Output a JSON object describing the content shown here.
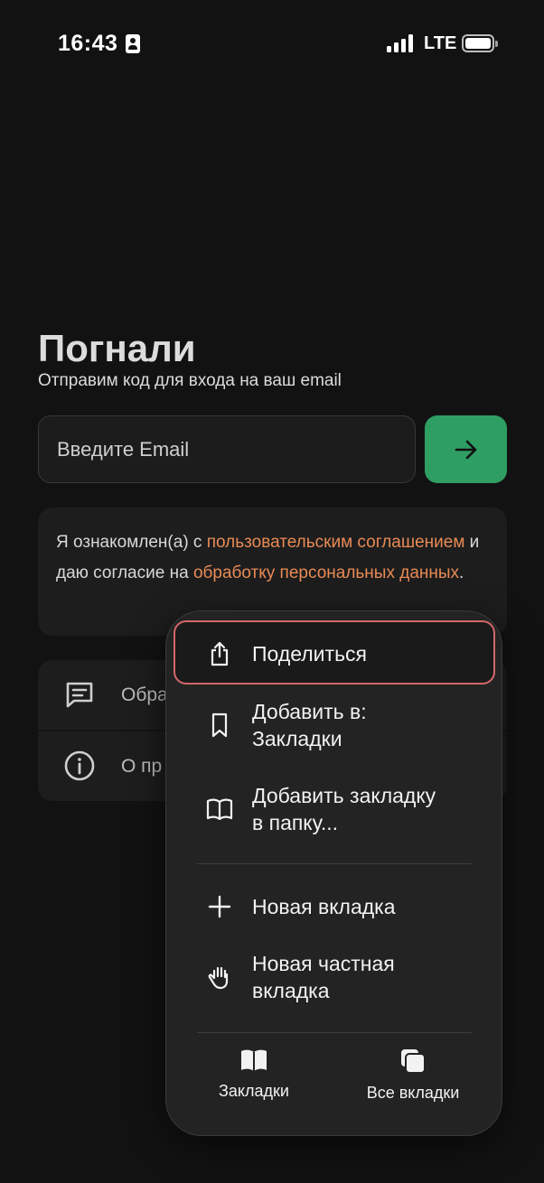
{
  "status_bar": {
    "time": "16:43",
    "network": "LTE"
  },
  "login": {
    "title": "Погнали",
    "subtitle": "Отправим код для входа на ваш email",
    "email_placeholder": "Введите Email",
    "accent_color": "#2e9e63"
  },
  "consent": {
    "part1": "Я ознакомлен(а) с ",
    "link1": "пользовательским соглашением",
    "part2": " и даю согласие на ",
    "link2": "обработку персональных данных",
    "part3": ".",
    "link_color": "#e88a55"
  },
  "list": {
    "items": [
      {
        "label": "Обра",
        "icon": "message-icon"
      },
      {
        "label": "О пр",
        "icon": "info-icon"
      }
    ]
  },
  "context_menu": {
    "share": "Поделиться",
    "add_bookmarks_line1": "Добавить в:",
    "add_bookmarks_line2": "Закладки",
    "add_folder_line1": "Добавить закладку",
    "add_folder_line2": "в папку...",
    "new_tab": "Новая вкладка",
    "private_tab_line1": "Новая частная",
    "private_tab_line2": "вкладка",
    "bottom_bookmarks": "Закладки",
    "bottom_all_tabs": "Все вкладки",
    "highlight_color": "#d4666a"
  }
}
